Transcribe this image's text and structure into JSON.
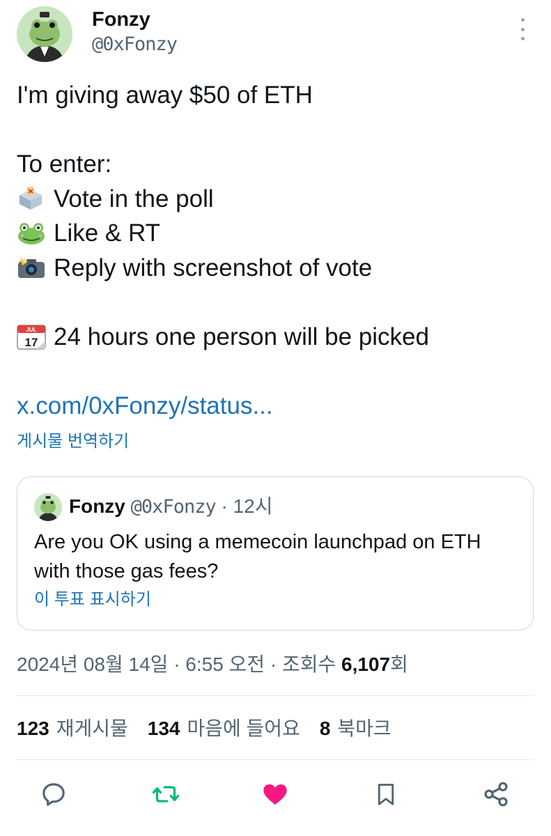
{
  "author": {
    "name": "Fonzy",
    "handle": "@0xFonzy",
    "avatar": "frog-avatar"
  },
  "tweet": {
    "lines": [
      {
        "emoji": "",
        "text": "I'm giving away $50 of ETH"
      },
      {
        "emoji": "",
        "text": ""
      },
      {
        "emoji": "",
        "text": "To enter:"
      },
      {
        "emoji": "ballot-box-icon",
        "text": "Vote in the poll"
      },
      {
        "emoji": "frog-icon",
        "text": "Like & RT"
      },
      {
        "emoji": "camera-flash-icon",
        "text": "Reply with screenshot of vote"
      },
      {
        "emoji": "",
        "text": ""
      },
      {
        "emoji": "calendar-icon",
        "text": "24 hours one person will be picked"
      },
      {
        "emoji": "",
        "text": ""
      }
    ],
    "link": "x.com/0xFonzy/status...",
    "translate": "게시물 번역하기",
    "calendar_month": "JUL",
    "calendar_day": "17"
  },
  "quote": {
    "name": "Fonzy",
    "handle": "@0xFonzy",
    "time": "· 12시",
    "text": "Are you OK using a memecoin launchpad on ETH with those gas fees?",
    "poll_link": "이 투표 표시하기"
  },
  "meta": {
    "datetime": "2024년 08월 14일 · 6:55 오전 · 조회수 ",
    "views": "6,107",
    "views_suffix": "회"
  },
  "stats": {
    "reposts_count": "123",
    "reposts_label": "재게시물",
    "likes_count": "134",
    "likes_label": "마음에 들어요",
    "bookmarks_count": "8",
    "bookmarks_label": "북마크"
  },
  "colors": {
    "link": "#1d73b6",
    "secondary_text": "#536471",
    "repost_active": "#00ba7c",
    "like_active": "#f91880",
    "icon": "#536471"
  }
}
